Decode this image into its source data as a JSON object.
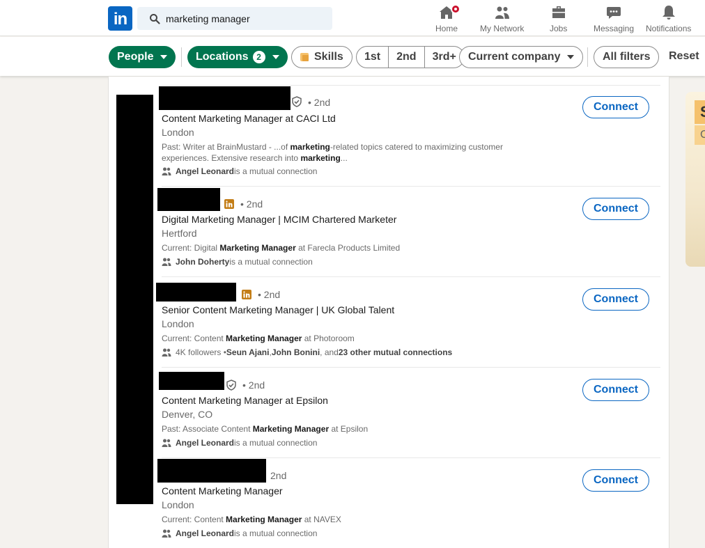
{
  "nav": {
    "logo": "in",
    "search_value": "marketing manager",
    "items": [
      {
        "label": "Home",
        "icon": "home-icon"
      },
      {
        "label": "My Network",
        "icon": "network-icon"
      },
      {
        "label": "Jobs",
        "icon": "jobs-icon"
      },
      {
        "label": "Messaging",
        "icon": "messaging-icon"
      },
      {
        "label": "Notifications",
        "icon": "notifications-icon"
      }
    ]
  },
  "filters": {
    "people": "People",
    "locations": "Locations",
    "locations_count": "2",
    "skills": "Skills",
    "degrees": [
      "1st",
      "2nd",
      "3rd+"
    ],
    "current_company": "Current company",
    "all_filters": "All filters",
    "reset": "Reset"
  },
  "colors": {
    "brand": "#0a66c2",
    "filter_active": "#01754f",
    "notification_badge": "#cb112d"
  },
  "results": [
    {
      "degree": "• 2nd",
      "badge": "verified-icon",
      "headline": "Content Marketing Manager at CACI Ltd",
      "location": "London",
      "summary_prefix": "Past: Writer at BrainMustard - ...of ",
      "summary_bold1": "marketing",
      "summary_mid": "-related topics catered to maximizing customer experiences. Extensive research into ",
      "summary_bold2": "marketing",
      "summary_suffix": "...",
      "mutual_name": "Angel Leonard",
      "mutual_text": " is a mutual connection",
      "connect": "Connect"
    },
    {
      "degree": "• 2nd",
      "badge": "linkedin-premium-icon",
      "headline": "Digital Marketing Manager | MCIM Chartered Marketer",
      "location": "Hertford",
      "summary_prefix": "Current: Digital ",
      "summary_bold1": "Marketing Manager",
      "summary_mid": " at Farecla Products Limited",
      "mutual_name": "John Doherty",
      "mutual_text": " is a mutual connection",
      "connect": "Connect"
    },
    {
      "degree": "• 2nd",
      "badge": "linkedin-premium-icon",
      "headline": "Senior Content Marketing Manager | UK Global Talent",
      "location": "London",
      "summary_prefix": "Current: Content ",
      "summary_bold1": "Marketing Manager",
      "summary_mid": " at Photoroom",
      "followers": "4K followers • ",
      "mutual_name": "Seun Ajani",
      "mutual_sep1": ", ",
      "mutual_name2": "John Bonini",
      "mutual_sep2": ", and ",
      "mutual_name3": "23 other mutual connections",
      "connect": "Connect"
    },
    {
      "degree": "• 2nd",
      "badge": "verified-icon",
      "headline": "Content Marketing Manager at Epsilon",
      "location": "Denver, CO",
      "summary_prefix": "Past: Associate Content ",
      "summary_bold1": "Marketing Manager",
      "summary_mid": " at Epsilon",
      "mutual_name": "Angel Leonard",
      "mutual_text": " is a mutual connection",
      "connect": "Connect"
    },
    {
      "degree": "2nd",
      "headline": "Content Marketing Manager",
      "location": "London",
      "summary_prefix": "Current: Content ",
      "summary_bold1": "Marketing Manager",
      "summary_mid": " at NAVEX",
      "mutual_name": "Angel Leonard",
      "mutual_text": " is a mutual connection",
      "connect": "Connect"
    }
  ],
  "ad": {
    "line1": "S",
    "line2": "C"
  }
}
